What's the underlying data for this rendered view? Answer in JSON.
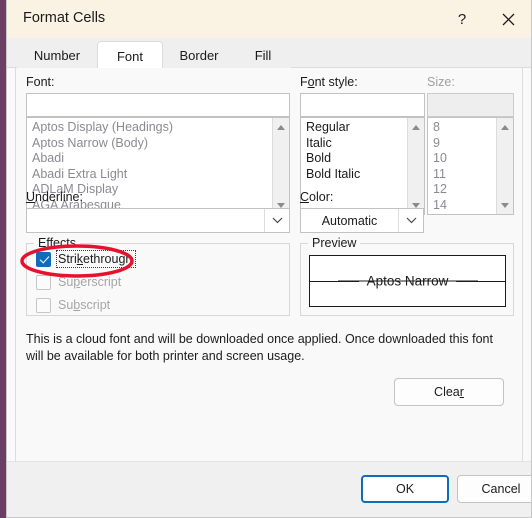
{
  "window": {
    "title": "Format Cells",
    "help_icon": "question-mark-icon",
    "close_icon": "close-x-icon"
  },
  "tabs": [
    {
      "label": "Number",
      "selected": false
    },
    {
      "label": "Font",
      "selected": true
    },
    {
      "label": "Border",
      "selected": false
    },
    {
      "label": "Fill",
      "selected": false
    }
  ],
  "font_section": {
    "label": "Font:",
    "input_value": "",
    "items": [
      "Aptos Display (Headings)",
      "Aptos Narrow (Body)",
      "Abadi",
      "Abadi Extra Light",
      "ADLaM Display",
      "AGA Arabesque"
    ]
  },
  "font_style_section": {
    "label_pre": "F",
    "label_accel": "o",
    "label_post": "nt style:",
    "label_full": "Font style:",
    "input_value": "",
    "items": [
      "Regular",
      "Italic",
      "Bold",
      "Bold Italic"
    ]
  },
  "size_section": {
    "label": "Size:",
    "input_value": "",
    "items": [
      "8",
      "9",
      "10",
      "11",
      "12",
      "14"
    ]
  },
  "underline_section": {
    "label_accel": "U",
    "label_post": "nderline:",
    "label_full": "Underline:",
    "value": ""
  },
  "color_section": {
    "label_accel": "C",
    "label_post": "olor:",
    "label_full": "Color:",
    "value": "Automatic"
  },
  "effects": {
    "group_label": "Effects",
    "items": [
      {
        "label_pre": "Stri",
        "label_accel": "k",
        "label_post": "ethrough",
        "label_full": "Strikethrough",
        "checked": true,
        "disabled": false,
        "focused": true
      },
      {
        "label_pre": "Su",
        "label_accel": "p",
        "label_post": "erscript",
        "label_full": "Superscript",
        "checked": false,
        "disabled": true,
        "focused": false
      },
      {
        "label_pre": "Su",
        "label_accel": "b",
        "label_post": "script",
        "label_full": "Subscript",
        "checked": false,
        "disabled": true,
        "focused": false
      }
    ]
  },
  "preview": {
    "group_label": "Preview",
    "text": "Aptos Narrow",
    "strikethrough": true
  },
  "info": {
    "text": "This is a cloud font and will be downloaded once applied. Once downloaded this font will be available for both printer and screen usage."
  },
  "buttons": {
    "clear_pre": "Clea",
    "clear_accel": "r",
    "clear_full": "Clear",
    "ok": "OK",
    "cancel": "Cancel"
  },
  "colors": {
    "accent": "#0f6cbd",
    "titlebar": "#faf3e4",
    "annotation": "#e8112d",
    "panel": "#f9f9f9"
  },
  "annotation": {
    "shape": "red-ellipse-highlight",
    "target": "strikethrough-checkbox"
  }
}
